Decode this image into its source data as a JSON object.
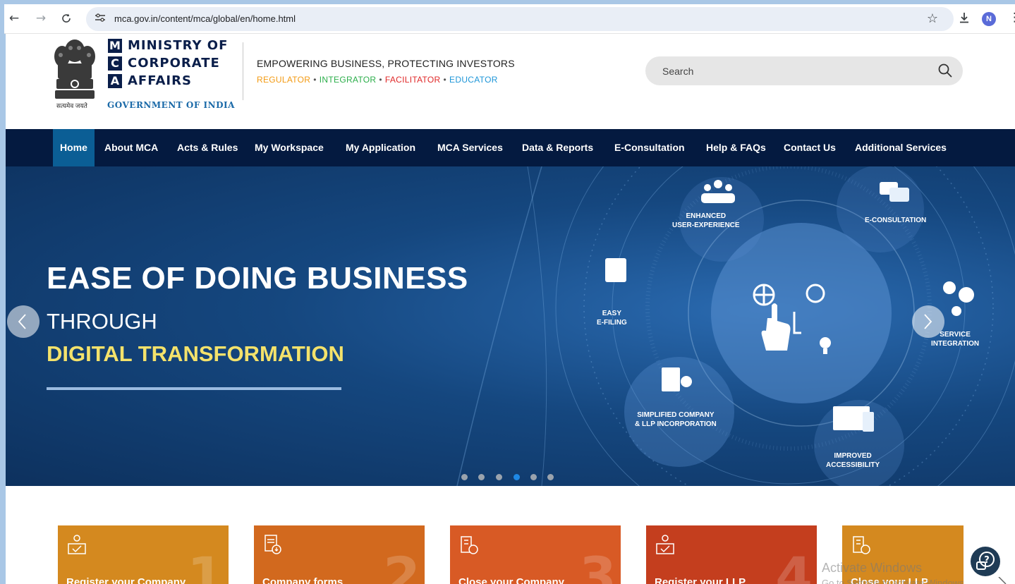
{
  "browser": {
    "back_icon": "←",
    "forward_icon": "→",
    "reload_icon": "C",
    "site_info_icon": "⚌",
    "url": "mca.gov.in/content/mca/global/en/home.html",
    "star_icon": "☆",
    "download_icon": "⤓",
    "avatar_letter": "N",
    "menu_icon": "⋮"
  },
  "header": {
    "logo_lines": [
      {
        "letter": "M",
        "word": "MINISTRY OF"
      },
      {
        "letter": "C",
        "word": "CORPORATE"
      },
      {
        "letter": "A",
        "word": "AFFAIRS"
      }
    ],
    "government": "GOVERNMENT OF INDIA",
    "emblem_caption": "सत्यमेव जयते",
    "tagline": "EMPOWERING BUSINESS, PROTECTING INVESTORS",
    "roles": [
      {
        "label": "REGULATOR",
        "color": "#f39a12"
      },
      {
        "label": "INTEGRATOR",
        "color": "#2bae4a"
      },
      {
        "label": "FACILITATOR",
        "color": "#e02828"
      },
      {
        "label": "EDUCATOR",
        "color": "#1e96d8"
      }
    ],
    "role_separator": "•",
    "search_placeholder": "Search"
  },
  "nav": {
    "items": [
      {
        "label": "Home",
        "active": true
      },
      {
        "label": "About MCA"
      },
      {
        "label": "Acts & Rules"
      },
      {
        "label": "My Workspace"
      },
      {
        "label": "My Application"
      },
      {
        "label": "MCA Services"
      },
      {
        "label": "Data & Reports"
      },
      {
        "label": "E-Consultation"
      },
      {
        "label": "Help & FAQs"
      },
      {
        "label": "Contact Us"
      },
      {
        "label": "Additional Services"
      }
    ]
  },
  "hero": {
    "title": "EASE OF DOING BUSINESS",
    "subtitle": "THROUGH",
    "accent": "DIGITAL TRANSFORMATION",
    "labels": {
      "enhanced": [
        "ENHANCED",
        "USER-EXPERIENCE"
      ],
      "econsult": [
        "E-CONSULTATION"
      ],
      "efiling": [
        "EASY",
        "E-FILING"
      ],
      "service": [
        "SERVICE",
        "INTEGRATION"
      ],
      "simplified": [
        "SIMPLIFIED COMPANY",
        "& LLP INCORPORATION"
      ],
      "improved": [
        "IMPROVED",
        "ACCESSIBILITY"
      ]
    },
    "dots": 6,
    "active_dot": 3
  },
  "cards": [
    {
      "title": "Register your Company",
      "number": "1",
      "color": "#d4891f",
      "icon": "register-icon"
    },
    {
      "title": "Company forms",
      "number": "2",
      "color": "#d2691e",
      "icon": "forms-icon"
    },
    {
      "title": "Close your Company",
      "number": "3",
      "color": "#d85a25",
      "icon": "close-company-icon"
    },
    {
      "title": "Register your LLP",
      "number": "4",
      "color": "#c43e1e",
      "icon": "register-llp-icon"
    },
    {
      "title": "Close your LLP",
      "number": "",
      "color": "#d4891f",
      "icon": "close-llp-icon"
    }
  ],
  "watermark": {
    "title": "Activate Windows",
    "subtitle": "Go to Settings to activate Windows."
  }
}
